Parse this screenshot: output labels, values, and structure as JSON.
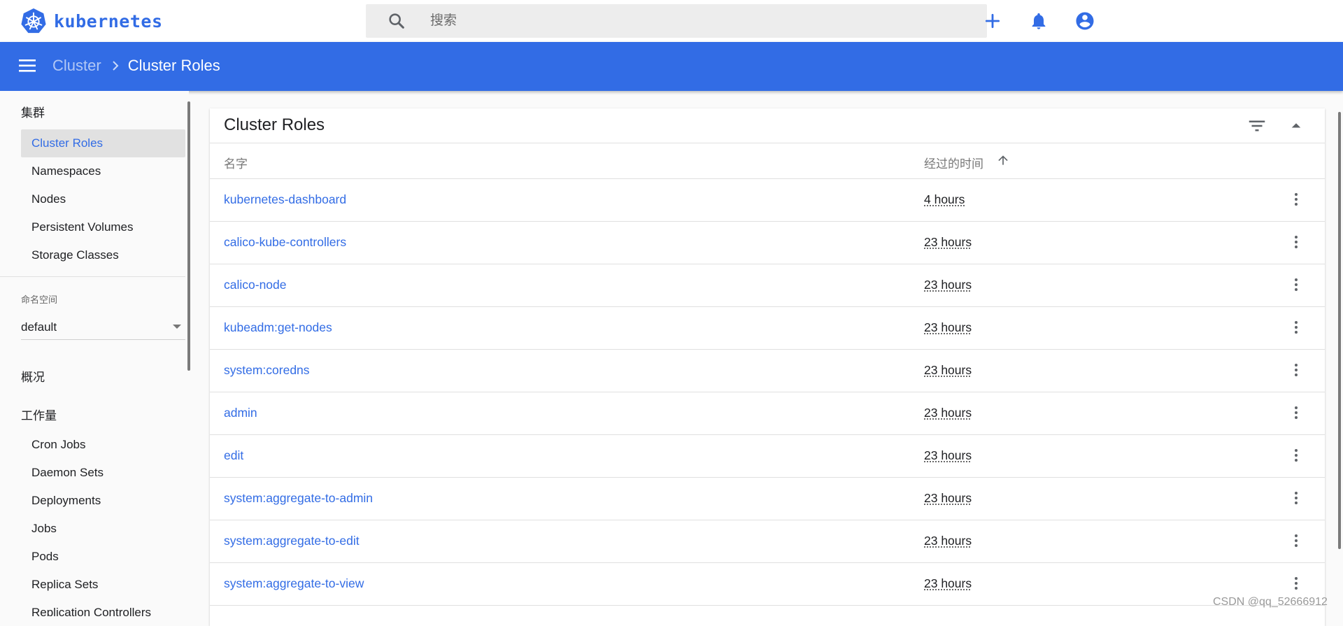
{
  "app": {
    "logo_text": "kubernetes"
  },
  "search": {
    "placeholder": "搜索"
  },
  "top_actions": {
    "icons": [
      "add-icon",
      "notifications-icon",
      "account-circle-icon"
    ]
  },
  "accent_color": "#326ce5",
  "breadcrumb": {
    "parent": "Cluster",
    "current": "Cluster Roles"
  },
  "sidebar": {
    "cluster_heading": "集群",
    "cluster_items": [
      {
        "label": "Cluster Roles",
        "active": true
      },
      {
        "label": "Namespaces"
      },
      {
        "label": "Nodes"
      },
      {
        "label": "Persistent Volumes"
      },
      {
        "label": "Storage Classes"
      }
    ],
    "namespace_label": "命名空间",
    "namespace_value": "default",
    "overview_heading": "概况",
    "workloads_heading": "工作量",
    "workload_items": [
      {
        "label": "Cron Jobs"
      },
      {
        "label": "Daemon Sets"
      },
      {
        "label": "Deployments"
      },
      {
        "label": "Jobs"
      },
      {
        "label": "Pods"
      },
      {
        "label": "Replica Sets"
      },
      {
        "label": "Replication Controllers"
      }
    ]
  },
  "card": {
    "title": "Cluster Roles"
  },
  "table": {
    "columns": {
      "name": "名字",
      "age": "经过的时间"
    },
    "rows": [
      {
        "name": "kubernetes-dashboard",
        "age": "4 hours"
      },
      {
        "name": "calico-kube-controllers",
        "age": "23 hours"
      },
      {
        "name": "calico-node",
        "age": "23 hours"
      },
      {
        "name": "kubeadm:get-nodes",
        "age": "23 hours"
      },
      {
        "name": "system:coredns",
        "age": "23 hours"
      },
      {
        "name": "admin",
        "age": "23 hours"
      },
      {
        "name": "edit",
        "age": "23 hours"
      },
      {
        "name": "system:aggregate-to-admin",
        "age": "23 hours"
      },
      {
        "name": "system:aggregate-to-edit",
        "age": "23 hours"
      },
      {
        "name": "system:aggregate-to-view",
        "age": "23 hours"
      }
    ]
  },
  "watermark": "CSDN @qq_52666912"
}
